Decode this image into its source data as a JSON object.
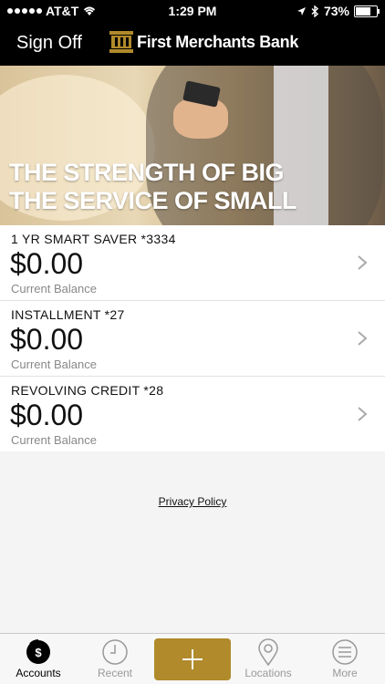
{
  "status_bar": {
    "carrier": "AT&T",
    "time": "1:29 PM",
    "battery": "73%"
  },
  "header": {
    "sign_off": "Sign Off",
    "brand_name": "First Merchants Bank"
  },
  "hero": {
    "line1": "THE STRENGTH OF BIG",
    "line2": "THE SERVICE OF SMALL"
  },
  "accounts": [
    {
      "name": "1 YR SMART SAVER *3334",
      "balance": "$0.00",
      "caption": "Current Balance"
    },
    {
      "name": "INSTALLMENT *27",
      "balance": "$0.00",
      "caption": "Current Balance"
    },
    {
      "name": "REVOLVING CREDIT *28",
      "balance": "$0.00",
      "caption": "Current Balance"
    }
  ],
  "footer": {
    "privacy": "Privacy Policy"
  },
  "tabbar": {
    "accounts": "Accounts",
    "recent": "Recent",
    "locations": "Locations",
    "more": "More",
    "accounts_icon_glyph": "$"
  },
  "colors": {
    "brand_gold": "#b08a2b",
    "header_bg": "#000000"
  }
}
